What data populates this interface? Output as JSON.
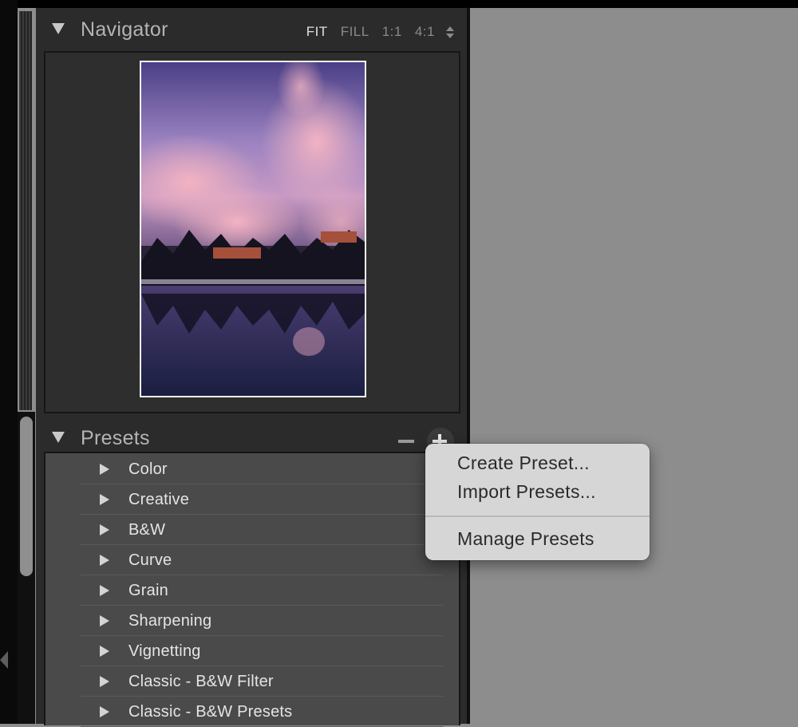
{
  "navigator": {
    "title": "Navigator",
    "zoom_options": [
      "FIT",
      "FILL",
      "1:1",
      "4:1"
    ],
    "active_zoom": "FIT"
  },
  "presets": {
    "title": "Presets",
    "items": [
      {
        "label": "Color"
      },
      {
        "label": "Creative"
      },
      {
        "label": "B&W"
      },
      {
        "label": "Curve"
      },
      {
        "label": "Grain"
      },
      {
        "label": "Sharpening"
      },
      {
        "label": "Vignetting"
      },
      {
        "label": "Classic - B&W Filter"
      },
      {
        "label": "Classic - B&W Presets"
      }
    ]
  },
  "context_menu": {
    "items": [
      "Create Preset...",
      "Import Presets...",
      "Manage Presets"
    ]
  },
  "icons": {
    "navigator_disclosure": "disclosure-triangle-down-icon",
    "presets_disclosure": "disclosure-triangle-down-icon",
    "remove_preset": "minus-icon",
    "add_preset": "plus-icon",
    "folder_disclosure": "disclosure-triangle-right-icon"
  }
}
